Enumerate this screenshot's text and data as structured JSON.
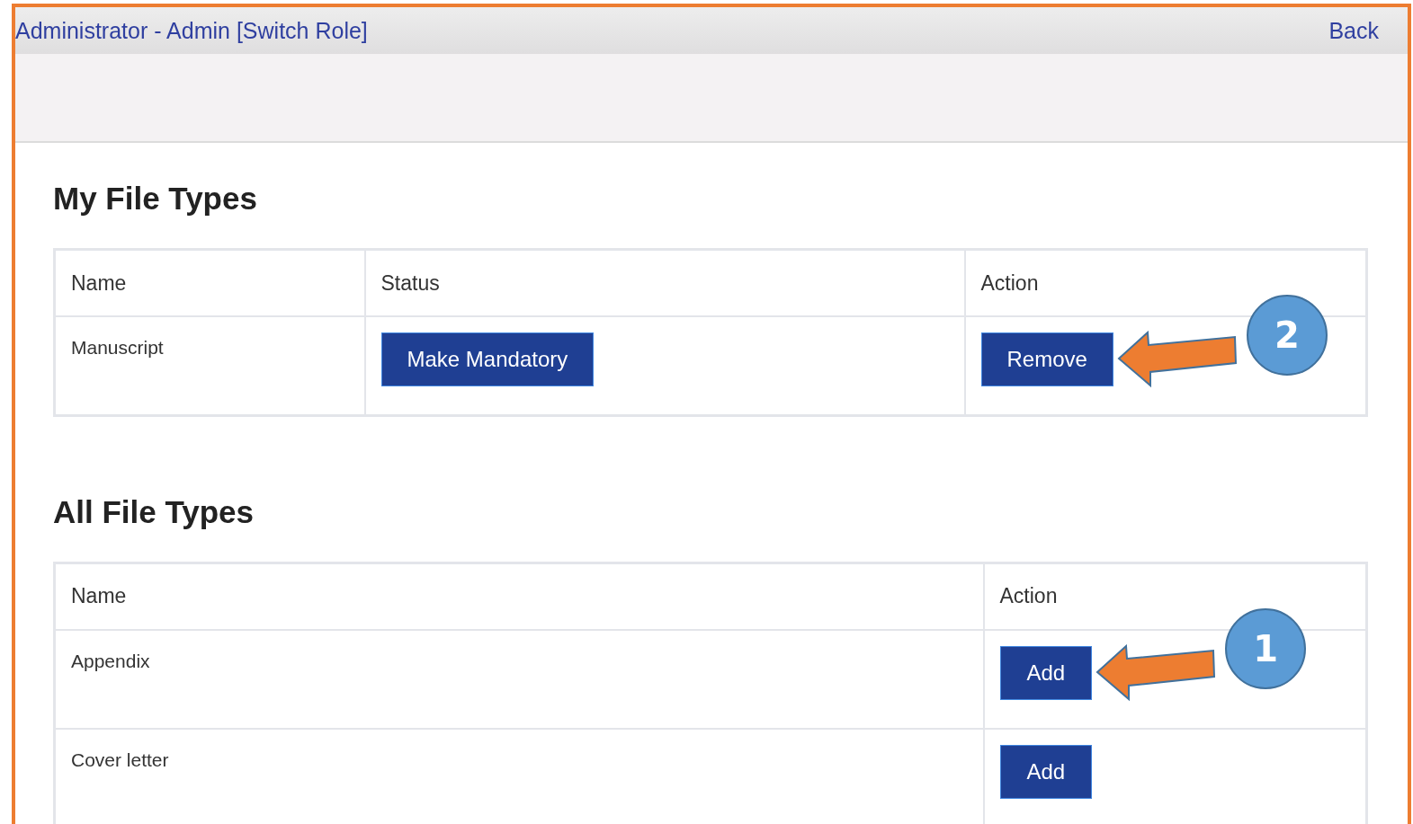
{
  "header": {
    "role_text": "Administrator - Admin [Switch Role]",
    "back_link": "Back"
  },
  "my_file_types": {
    "title": "My File Types",
    "columns": [
      "Name",
      "Status",
      "Action"
    ],
    "rows": [
      {
        "name": "Manuscript",
        "status_button": "Make Mandatory",
        "action_button": "Remove",
        "callout": "2"
      }
    ]
  },
  "all_file_types": {
    "title": "All File Types",
    "columns": [
      "Name",
      "Action"
    ],
    "rows": [
      {
        "name": "Appendix",
        "action_button": "Add",
        "callout": "1"
      },
      {
        "name": "Cover letter",
        "action_button": "Add"
      }
    ]
  }
}
